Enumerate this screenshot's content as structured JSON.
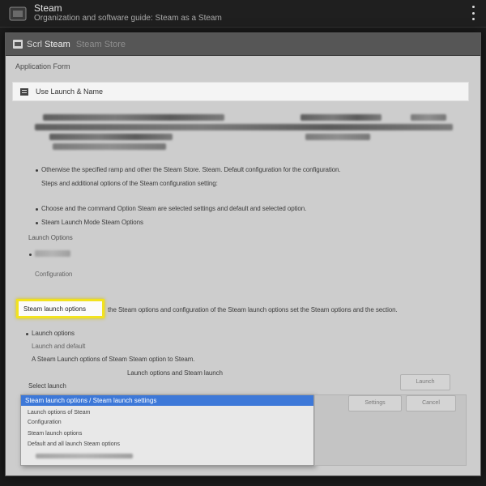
{
  "app": {
    "title": "Steam",
    "subtitle": "Organization and software guide: Steam as a Steam"
  },
  "window": {
    "title_prefix": "Scrl",
    "title_main": "Steam",
    "title_suffix": "Steam Store"
  },
  "content": {
    "section_label": "Application Form",
    "highlight_bar_text": "Use Launch & Name",
    "row1": "Otherwise the specified ramp and other the Steam Store. Steam. Default configuration for the configuration.",
    "row2": "Steps and additional options of the Steam configuration setting:",
    "row3": "Choose and the command Option Steam are selected settings and default and selected option.",
    "row4": "Steam Launch Mode Steam Options",
    "row5": "Launch Options",
    "row6": "Configuration",
    "callout_label": "Steam launch options",
    "callout_after": "the Steam options and configuration of the Steam launch options set the Steam options and the section.",
    "row7": "Launch options",
    "row8": "Launch and default",
    "row9": "A Steam Launch options of Steam Steam option to Steam.",
    "row10": "Launch options and Steam launch",
    "row11": "Select launch"
  },
  "dropdown": {
    "selected": "Steam launch options / Steam launch settings",
    "items": [
      "Launch options of Steam",
      "Configuration",
      "Steam launch options",
      "Default and all launch Steam options"
    ]
  },
  "buttons": {
    "primary": "Launch",
    "secondary": "Settings",
    "tertiary": "Cancel"
  }
}
